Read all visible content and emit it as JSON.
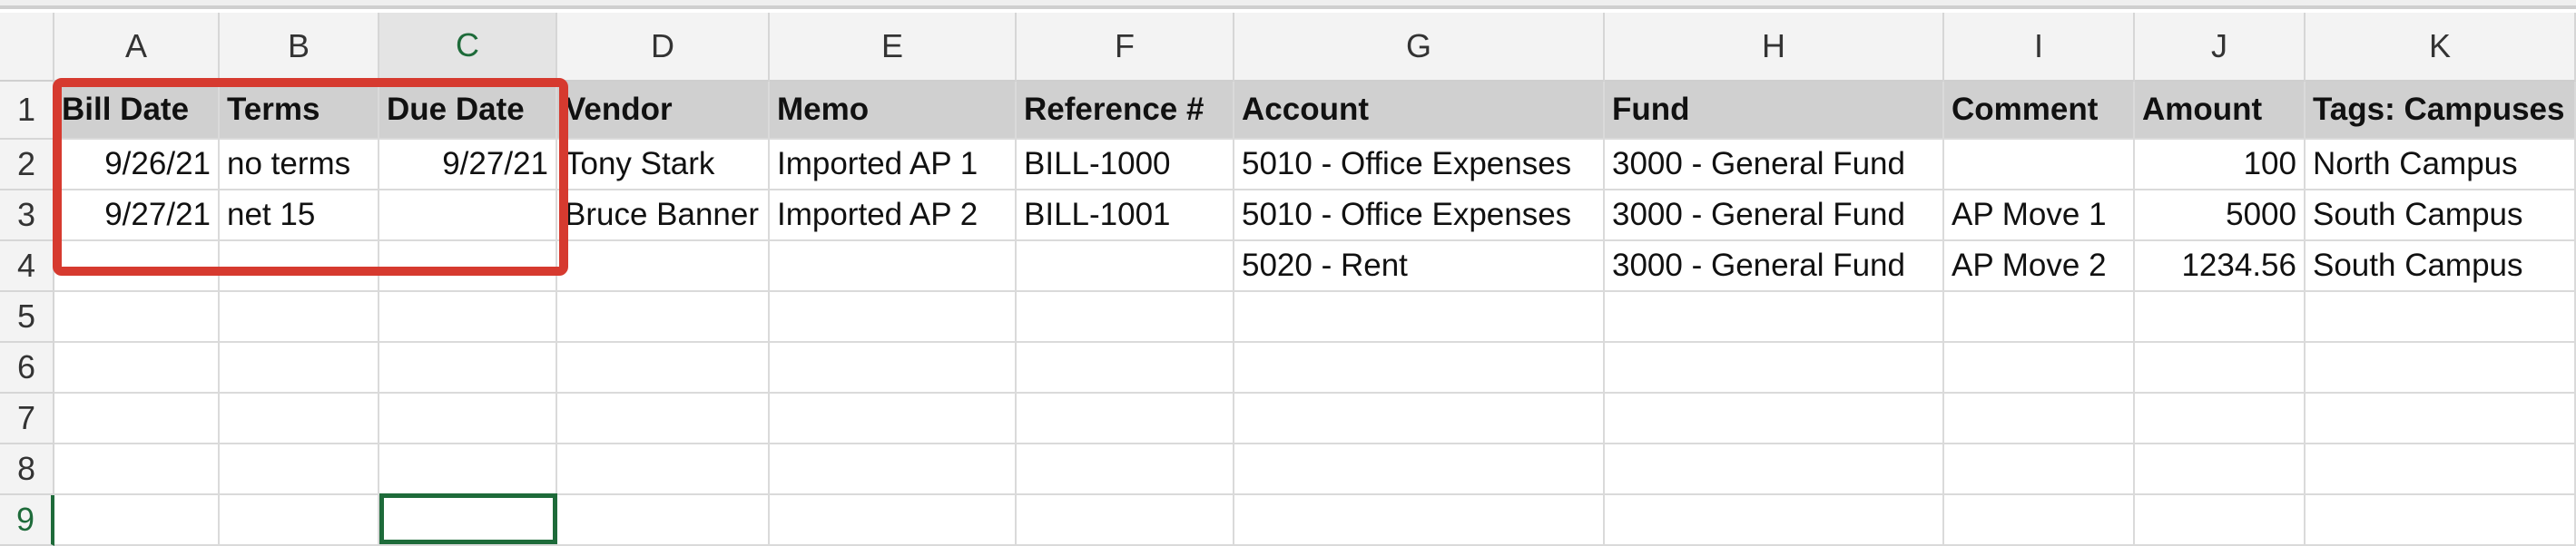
{
  "columns": [
    "A",
    "B",
    "C",
    "D",
    "E",
    "F",
    "G",
    "H",
    "I",
    "J",
    "K"
  ],
  "rows": [
    "1",
    "2",
    "3",
    "4",
    "5",
    "6",
    "7",
    "8",
    "9"
  ],
  "selected_cell": "C9",
  "highlight_color": "#d63a2f",
  "accent_color": "#1e6b3a",
  "header_row": {
    "A": "Bill Date",
    "B": "Terms",
    "C": "Due Date",
    "D": "Vendor",
    "E": "Memo",
    "F": "Reference #",
    "G": "Account",
    "H": "Fund",
    "I": "Comment",
    "J": "Amount",
    "K": "Tags: Campuses"
  },
  "data_rows": [
    {
      "A": "9/26/21",
      "B": "no terms",
      "C": "9/27/21",
      "D": "Tony Stark",
      "E": "Imported AP 1",
      "F": "BILL-1000",
      "G": "5010 - Office Expenses",
      "H": "3000 - General Fund",
      "I": "",
      "J": "100",
      "K": "North Campus"
    },
    {
      "A": "9/27/21",
      "B": "net 15",
      "C": "",
      "D": "Bruce Banner",
      "E": "Imported AP 2",
      "F": "BILL-1001",
      "G": "5010 - Office Expenses",
      "H": "3000 - General Fund",
      "I": "AP Move 1",
      "J": "5000",
      "K": "South Campus"
    },
    {
      "A": "",
      "B": "",
      "C": "",
      "D": "",
      "E": "",
      "F": "",
      "G": "5020 - Rent",
      "H": "3000 - General Fund",
      "I": "AP Move 2",
      "J": "1234.56",
      "K": "South Campus"
    }
  ]
}
